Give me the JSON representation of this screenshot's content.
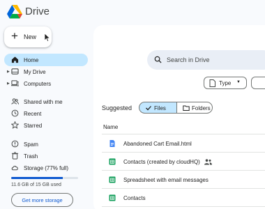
{
  "app": {
    "title": "Drive"
  },
  "new_button": {
    "label": "New"
  },
  "sidebar": {
    "items": [
      {
        "label": "Home",
        "icon": "home-icon",
        "active": true
      },
      {
        "label": "My Drive",
        "icon": "my-drive-icon"
      },
      {
        "label": "Computers",
        "icon": "computers-icon"
      },
      {
        "label": "Shared with me",
        "icon": "shared-with-me-icon"
      },
      {
        "label": "Recent",
        "icon": "recent-icon"
      },
      {
        "label": "Starred",
        "icon": "star-icon"
      },
      {
        "label": "Spam",
        "icon": "spam-icon"
      },
      {
        "label": "Trash",
        "icon": "trash-icon"
      },
      {
        "label": "Storage (77% full)",
        "icon": "cloud-icon"
      }
    ]
  },
  "storage": {
    "used_text": "11.6 GB of 15 GB used",
    "fraction_used": 0.77,
    "cta": "Get more storage"
  },
  "search": {
    "placeholder": "Search in Drive"
  },
  "filters": {
    "type_label": "Type"
  },
  "suggested": {
    "heading": "Suggested",
    "toggle": {
      "files": "Files",
      "folders": "Folders",
      "selected": "Files"
    }
  },
  "table": {
    "column_name": "Name",
    "files": [
      {
        "name": "Abandoned Cart Email.html",
        "type": "docs",
        "shared": false
      },
      {
        "name": "Contacts (created by cloudHQ)",
        "type": "sheets",
        "shared": true
      },
      {
        "name": "Spreadsheet with email messages",
        "type": "sheets",
        "shared": false
      },
      {
        "name": "Contacts",
        "type": "sheets",
        "shared": false
      }
    ]
  },
  "colors": {
    "accent": "#0b57d0",
    "active_bg": "#c2e7ff",
    "sheets_green": "#0f9d58",
    "docs_blue": "#4285f4"
  }
}
